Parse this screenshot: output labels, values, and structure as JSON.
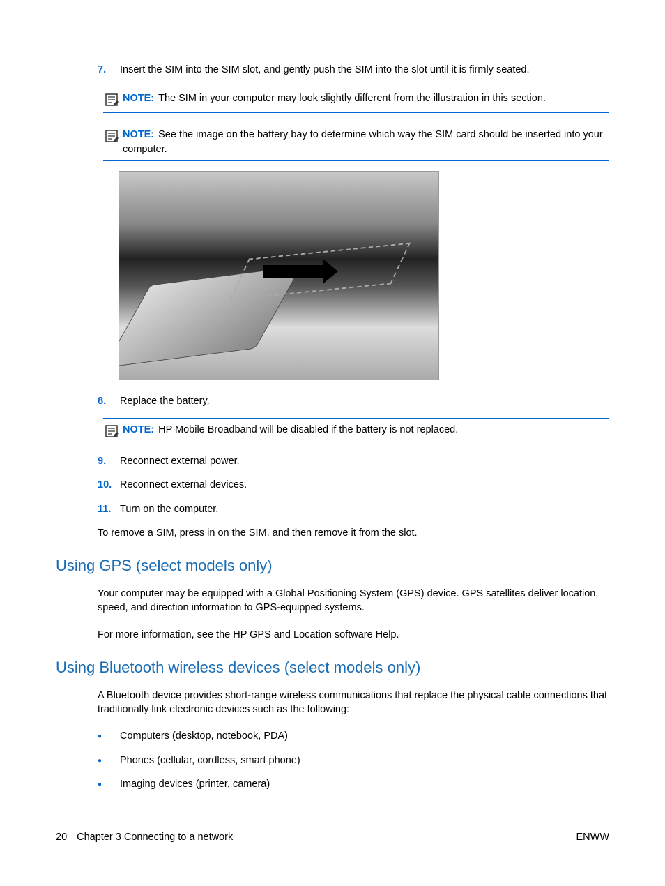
{
  "steps": {
    "s7": {
      "num": "7.",
      "text": "Insert the SIM into the SIM slot, and gently push the SIM into the slot until it is firmly seated."
    },
    "s8": {
      "num": "8.",
      "text": "Replace the battery."
    },
    "s9": {
      "num": "9.",
      "text": "Reconnect external power."
    },
    "s10": {
      "num": "10.",
      "text": "Reconnect external devices."
    },
    "s11": {
      "num": "11.",
      "text": "Turn on the computer."
    }
  },
  "notes": {
    "n1": {
      "label": "NOTE:",
      "text": "The SIM in your computer may look slightly different from the illustration in this section."
    },
    "n2": {
      "label": "NOTE:",
      "text": "See the image on the battery bay to determine which way the SIM card should be inserted into your computer."
    },
    "n3": {
      "label": "NOTE:",
      "text": "HP Mobile Broadband will be disabled if the battery is not replaced."
    }
  },
  "removeSimText": "To remove a SIM, press in on the SIM, and then remove it from the slot.",
  "gps": {
    "heading": "Using GPS (select models only)",
    "p1": "Your computer may be equipped with a Global Positioning System (GPS) device. GPS satellites deliver location, speed, and direction information to GPS-equipped systems.",
    "p2": "For more information, see the HP GPS and Location software Help."
  },
  "bluetooth": {
    "heading": "Using Bluetooth wireless devices (select models only)",
    "intro": "A Bluetooth device provides short-range wireless communications that replace the physical cable connections that traditionally link electronic devices such as the following:",
    "items": {
      "b1": "Computers (desktop, notebook, PDA)",
      "b2": "Phones (cellular, cordless, smart phone)",
      "b3": "Imaging devices (printer, camera)"
    }
  },
  "footer": {
    "page": "20",
    "chapter": "Chapter 3   Connecting to a network",
    "right": "ENWW"
  }
}
